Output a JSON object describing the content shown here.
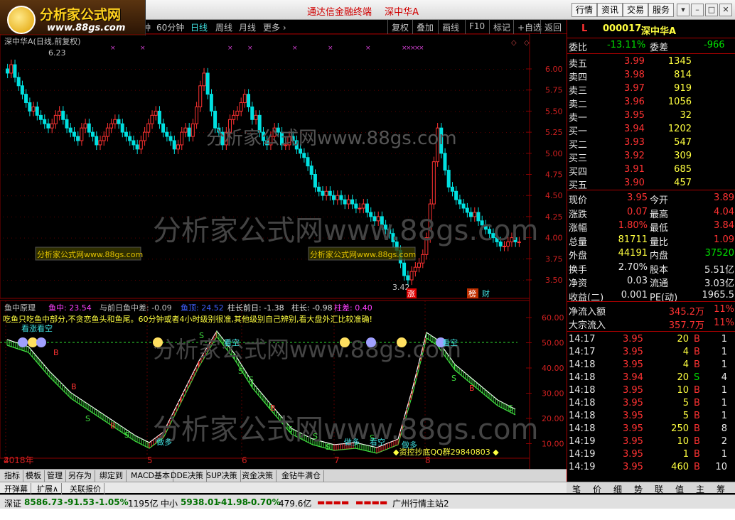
{
  "logo": {
    "text": "分析家公式网",
    "url": "www.88gs.com"
  },
  "title": {
    "terminal": "通达信金融终端",
    "stock": "深中华A"
  },
  "top_buttons": [
    "行情",
    "资讯",
    "交易",
    "服务"
  ],
  "win_buttons": [
    "▾",
    "–",
    "□",
    "✕"
  ],
  "periods": [
    "钟",
    "60分钟",
    "日线",
    "周线",
    "月线",
    "更多 ›"
  ],
  "active_period": "日线",
  "right_tools": [
    "复权",
    "叠加",
    "画线",
    "F10",
    "标记",
    "+自选",
    "返回"
  ],
  "chart": {
    "title": "深中华A(日线,前复权)",
    "high_label": "6.23",
    "low_label": "3.42",
    "price_ticks": [
      "6.00",
      "5.75",
      "5.50",
      "5.25",
      "5.00",
      "4.75",
      "4.50",
      "4.25",
      "4.00",
      "3.75",
      "3.50"
    ],
    "month_labels": [
      "2018年",
      "4",
      "5",
      "6",
      "7",
      "8"
    ],
    "watermark": "分析家公式网www.88gs.com",
    "badges": [
      "涨",
      "榜",
      "财"
    ],
    "colors": {
      "up": "#ff3232",
      "down": "#00e0e0",
      "ma": "#ffffff"
    }
  },
  "indicator": {
    "name": "鱼中原理",
    "labels": [
      {
        "k": "鱼中:",
        "v": "23.54"
      },
      {
        "k": "与前日鱼中差:",
        "v": "-0.09"
      },
      {
        "k": "鱼顶:",
        "v": "24.52"
      },
      {
        "k": "柱长前日:",
        "v": "-1.38"
      },
      {
        "k": "柱长:",
        "v": "-0.98"
      },
      {
        "k": "柱差:",
        "v": "0.40"
      }
    ],
    "note": "吃鱼只吃鱼中部分,不贪恋鱼头和鱼尾。60分钟或者4小时级别很准,其他级别自己辨别,看大盘外汇比较准确!",
    "ticks": [
      "60.00",
      "50.00",
      "40.00",
      "30.00",
      "20.00",
      "10.00"
    ],
    "tags": [
      "看涨看空",
      "看空",
      "看空",
      "看空",
      "做多",
      "做多",
      "看空",
      "做多"
    ],
    "qq_note": "◆资控抄底QQ群29840803 ◆"
  },
  "quote": {
    "code": "000017",
    "name": "深中华A",
    "flag": "L",
    "weibi_label": "委比",
    "weibi": "-13.11%",
    "weicha_label": "委差",
    "weicha": "-966",
    "sells": [
      {
        "l": "卖五",
        "p": "3.99",
        "v": "1345"
      },
      {
        "l": "卖四",
        "p": "3.98",
        "v": "814"
      },
      {
        "l": "卖三",
        "p": "3.97",
        "v": "919"
      },
      {
        "l": "卖二",
        "p": "3.96",
        "v": "1056"
      },
      {
        "l": "卖一",
        "p": "3.95",
        "v": "32"
      }
    ],
    "buys": [
      {
        "l": "买一",
        "p": "3.94",
        "v": "1202"
      },
      {
        "l": "买二",
        "p": "3.93",
        "v": "547"
      },
      {
        "l": "买三",
        "p": "3.92",
        "v": "309"
      },
      {
        "l": "买四",
        "p": "3.91",
        "v": "685"
      },
      {
        "l": "买五",
        "p": "3.90",
        "v": "457"
      }
    ],
    "stats": [
      {
        "a": "现价",
        "av": "3.95",
        "b": "今开",
        "bv": "3.89"
      },
      {
        "a": "涨跌",
        "av": "0.07",
        "b": "最高",
        "bv": "4.04"
      },
      {
        "a": "涨幅",
        "av": "1.80%",
        "b": "最低",
        "bv": "3.84"
      },
      {
        "a": "总量",
        "av": "81711",
        "b": "量比",
        "bv": "1.09"
      },
      {
        "a": "外盘",
        "av": "44191",
        "b": "内盘",
        "bv": "37520"
      },
      {
        "a": "换手",
        "av": "2.70%",
        "b": "股本",
        "bv": "5.51亿"
      },
      {
        "a": "净资",
        "av": "0.03",
        "b": "流通",
        "bv": "3.03亿"
      },
      {
        "a": "收益(二)",
        "av": "0.001",
        "b": "PE(动)",
        "bv": "1965.5"
      }
    ],
    "flows": [
      {
        "l": "净流入额",
        "v": "345.2万",
        "p": "11%"
      },
      {
        "l": "大宗流入",
        "v": "357.7万",
        "p": "11%"
      }
    ],
    "ticks": [
      {
        "t": "14:17",
        "p": "3.95",
        "v": "20",
        "s": "B",
        "n": "1"
      },
      {
        "t": "14:17",
        "p": "3.95",
        "v": "4",
        "s": "B",
        "n": "1"
      },
      {
        "t": "14:18",
        "p": "3.95",
        "v": "4",
        "s": "B",
        "n": "1"
      },
      {
        "t": "14:18",
        "p": "3.94",
        "v": "20",
        "s": "S",
        "n": "4"
      },
      {
        "t": "14:18",
        "p": "3.95",
        "v": "10",
        "s": "B",
        "n": "1"
      },
      {
        "t": "14:18",
        "p": "3.95",
        "v": "5",
        "s": "B",
        "n": "1"
      },
      {
        "t": "14:18",
        "p": "3.95",
        "v": "5",
        "s": "B",
        "n": "1"
      },
      {
        "t": "14:18",
        "p": "3.95",
        "v": "250",
        "s": "B",
        "n": "8"
      },
      {
        "t": "14:19",
        "p": "3.95",
        "v": "10",
        "s": "B",
        "n": "2"
      },
      {
        "t": "14:19",
        "p": "3.95",
        "v": "1",
        "s": "B",
        "n": "1"
      },
      {
        "t": "14:19",
        "p": "3.95",
        "v": "460",
        "s": "B",
        "n": "10"
      }
    ],
    "tabs": [
      "笔",
      "价",
      "细",
      "势",
      "联",
      "值",
      "主",
      "筹"
    ]
  },
  "bottom_tabs": [
    "指标",
    "模板",
    "管理",
    "另存为",
    "绑定到",
    "MACD基本",
    "DDE决策",
    "SUP决策",
    "资金决策",
    "金钻牛满仓"
  ],
  "bottom_tabs2": [
    "开弹幕",
    "扩展∧",
    "关联报价"
  ],
  "status": [
    {
      "k": "深证",
      "v": "8586.73",
      "c": "-91.53",
      "p": "-1.05%",
      "a": "1195亿"
    },
    {
      "k": "中小",
      "v": "5938.01",
      "c": "-41.98",
      "p": "-0.70%",
      "a": "479.6亿"
    }
  ],
  "status_site": "广州行情主站2"
}
